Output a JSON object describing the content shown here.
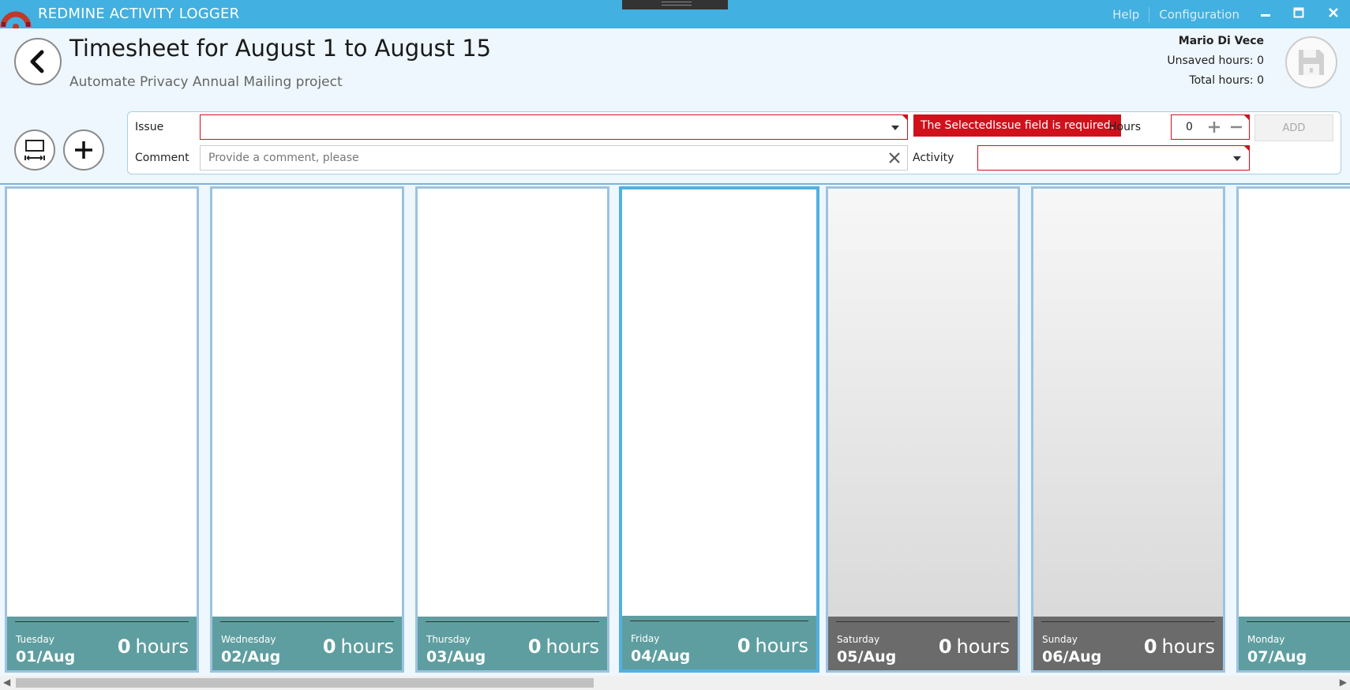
{
  "titlebar": {
    "title": "REDMINE ACTIVITY LOGGER",
    "help": "Help",
    "configuration": "Configuration"
  },
  "header": {
    "title": "Timesheet for August 1 to August 15",
    "subtitle": "Automate Privacy Annual Mailing project",
    "user": "Mario Di Vece",
    "unsaved": "Unsaved hours: 0",
    "total": "Total hours: 0"
  },
  "form": {
    "issue_label": "Issue",
    "issue_value": "",
    "comment_label": "Comment",
    "comment_placeholder": "Provide a comment, please",
    "error_message": "The SelectedIssue field is required.",
    "hours_label": "Hours",
    "hours_value": "0",
    "activity_label": "Activity",
    "activity_value": "",
    "add_label": "ADD"
  },
  "days": [
    {
      "name": "Tuesday",
      "date": "01/Aug",
      "hours": "0",
      "unit": "hours"
    },
    {
      "name": "Wednesday",
      "date": "02/Aug",
      "hours": "0",
      "unit": "hours"
    },
    {
      "name": "Thursday",
      "date": "03/Aug",
      "hours": "0",
      "unit": "hours"
    },
    {
      "name": "Friday",
      "date": "04/Aug",
      "hours": "0",
      "unit": "hours"
    },
    {
      "name": "Saturday",
      "date": "05/Aug",
      "hours": "0",
      "unit": "hours"
    },
    {
      "name": "Sunday",
      "date": "06/Aug",
      "hours": "0",
      "unit": "hours"
    },
    {
      "name": "Monday",
      "date": "07/Aug",
      "hours": "",
      "unit": ""
    }
  ],
  "colors": {
    "accent": "#42b0e0",
    "weekday_footer": "#5f9ea0",
    "weekend_footer": "#6b6b6b",
    "error": "#d0111c"
  }
}
